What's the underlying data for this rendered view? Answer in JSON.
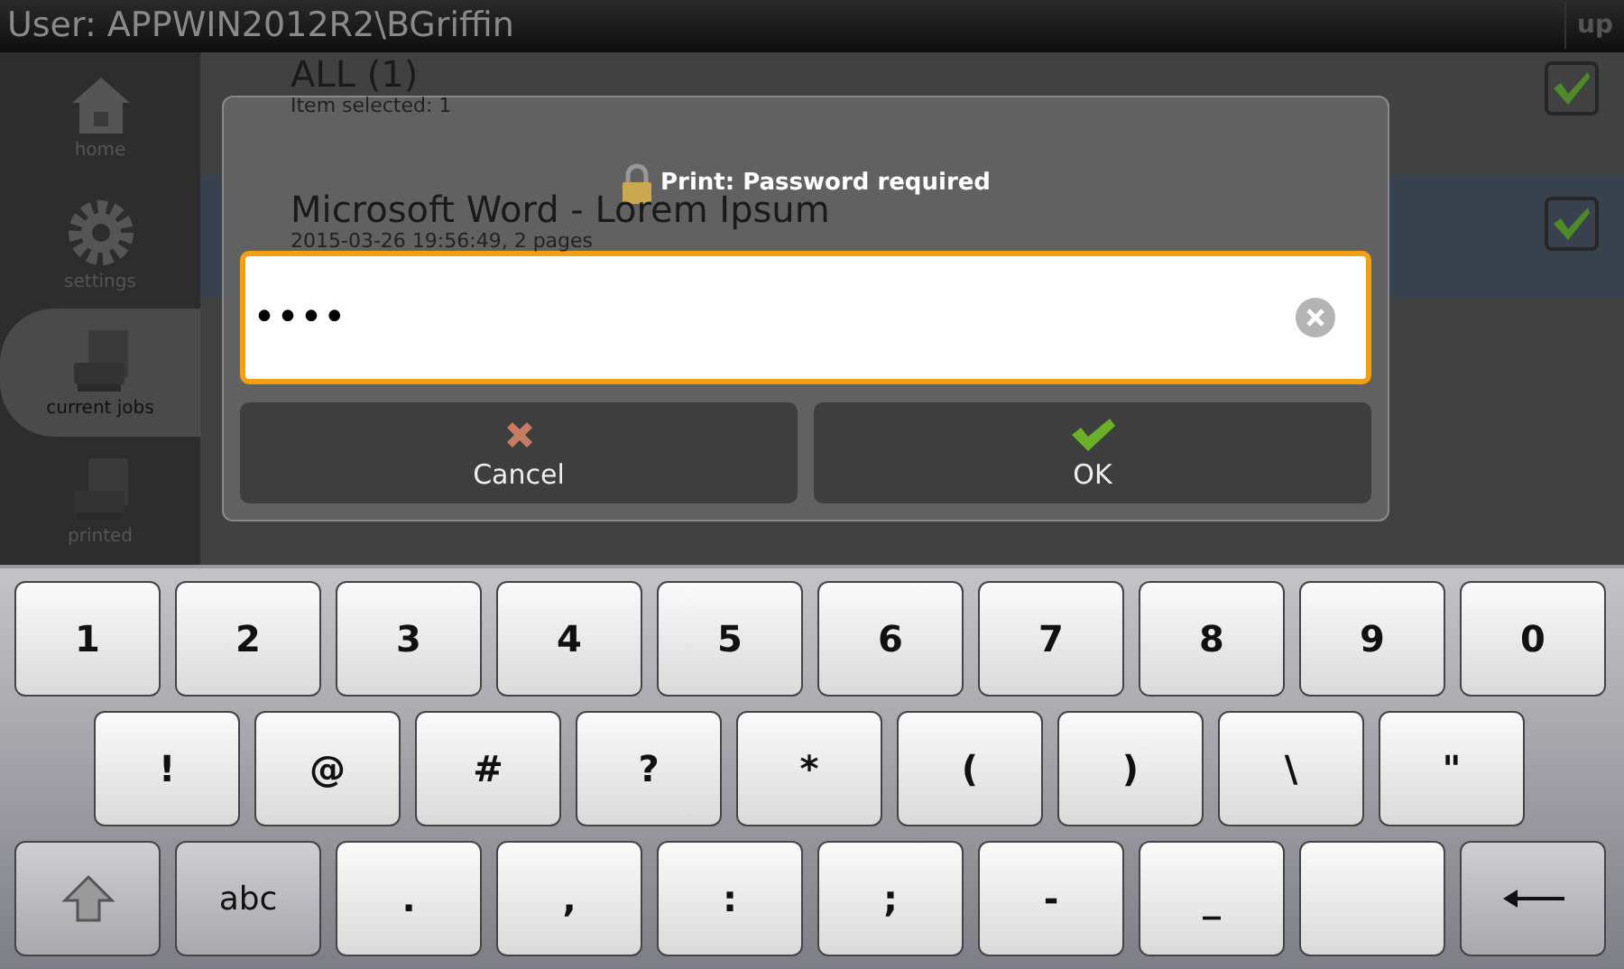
{
  "top_bar": {
    "user": "User: APPWIN2012R2\\BGriffin",
    "up_button": "up"
  },
  "sidebar": {
    "items": [
      {
        "label": "home",
        "kind": "home",
        "selected": false
      },
      {
        "label": "settings",
        "kind": "settings",
        "selected": false
      },
      {
        "label": "current jobs",
        "kind": "current",
        "selected": true
      },
      {
        "label": "printed",
        "kind": "printed",
        "selected": false
      }
    ]
  },
  "list": {
    "header": {
      "title": "ALL (1)",
      "subtitle": "Item selected: 1",
      "checked": true
    },
    "jobs": [
      {
        "title": "Microsoft Word - Lorem Ipsum",
        "details": "2015-03-26 19:56:49, 2 pages",
        "checked": true,
        "selected": true
      }
    ]
  },
  "dialog": {
    "title": "Print: Password required",
    "password": {
      "value": "••••"
    },
    "buttons": [
      {
        "label": "Cancel",
        "kind": "cancel"
      },
      {
        "label": "OK",
        "kind": "ok"
      }
    ]
  },
  "keyboard": {
    "rows": [
      [
        {
          "label": "1",
          "kind": "char"
        },
        {
          "label": "2",
          "kind": "char"
        },
        {
          "label": "3",
          "kind": "char"
        },
        {
          "label": "4",
          "kind": "char"
        },
        {
          "label": "5",
          "kind": "char"
        },
        {
          "label": "6",
          "kind": "char"
        },
        {
          "label": "7",
          "kind": "char"
        },
        {
          "label": "8",
          "kind": "char"
        },
        {
          "label": "9",
          "kind": "char"
        },
        {
          "label": "0",
          "kind": "char"
        }
      ],
      [
        {
          "label": "!",
          "kind": "char"
        },
        {
          "label": "@",
          "kind": "char"
        },
        {
          "label": "#",
          "kind": "char"
        },
        {
          "label": "?",
          "kind": "char"
        },
        {
          "label": "*",
          "kind": "char"
        },
        {
          "label": "(",
          "kind": "char"
        },
        {
          "label": ")",
          "kind": "char"
        },
        {
          "label": "\\",
          "kind": "char"
        },
        {
          "label": "\"",
          "kind": "char"
        }
      ],
      [
        {
          "kind": "shift"
        },
        {
          "label": "abc",
          "kind": "abc"
        },
        {
          "label": ".",
          "kind": "char"
        },
        {
          "label": ",",
          "kind": "char"
        },
        {
          "label": ":",
          "kind": "char"
        },
        {
          "label": ";",
          "kind": "char"
        },
        {
          "label": "-",
          "kind": "char"
        },
        {
          "label": "_",
          "kind": "char"
        },
        {
          "kind": "space"
        },
        {
          "kind": "backspace"
        }
      ]
    ]
  }
}
